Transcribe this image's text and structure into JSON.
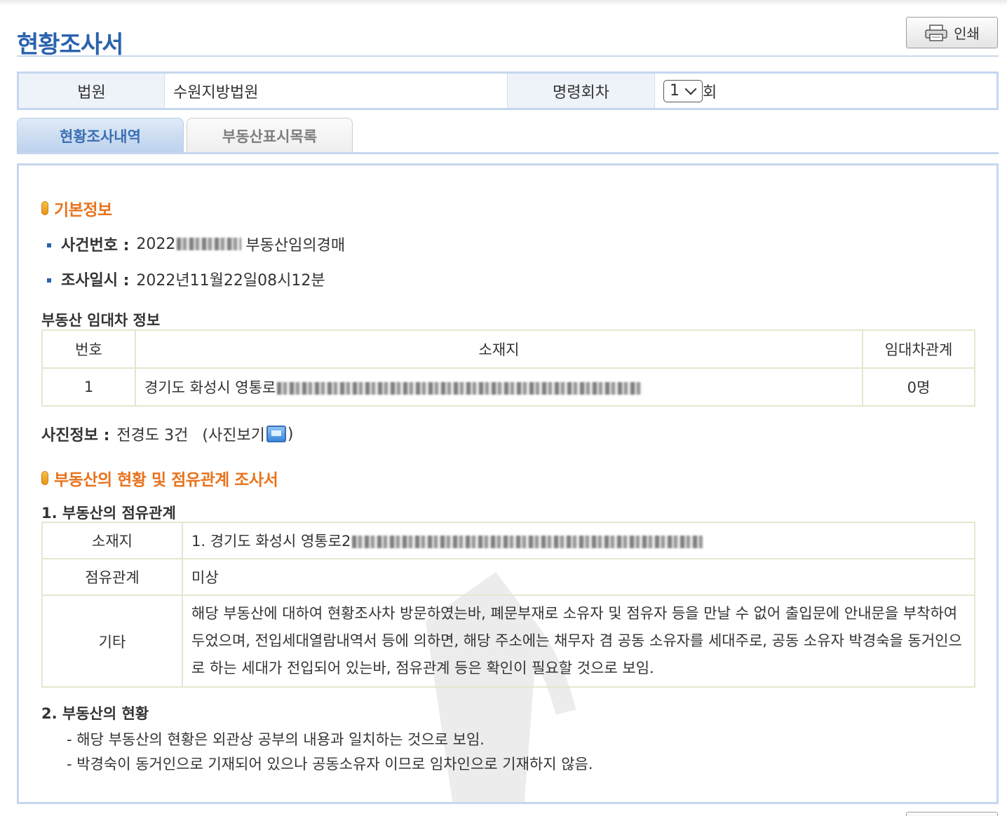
{
  "header": {
    "title": "현황조사서",
    "print_label": "인쇄"
  },
  "court": {
    "court_label": "법원",
    "court_value": "수원지방법원",
    "order_label": "명령회차",
    "order_value": "1",
    "order_suffix": "회"
  },
  "tabs": [
    {
      "label": "현황조사내역",
      "active": true
    },
    {
      "label": "부동산표시목록",
      "active": false
    }
  ],
  "basic_info": {
    "heading": "기본정보",
    "case_label": "사건번호 :",
    "case_prefix": "2022",
    "case_suffix": "부동산임의경매",
    "date_label": "조사일시 :",
    "date_value": "2022년11월22일08시12분"
  },
  "lease_info": {
    "heading": "부동산 임대차 정보",
    "columns": [
      "번호",
      "소재지",
      "임대차관계"
    ],
    "rows": [
      {
        "no": "1",
        "address_prefix": "경기도 화성시 영통로",
        "relation": "0명"
      }
    ]
  },
  "photo_info": {
    "label": "사진정보 :",
    "value": "전경도 3건",
    "view_open": "(사진보기",
    "view_close": ")"
  },
  "status_section": {
    "heading": "부동산의 현황 및 점유관계 조사서",
    "occupancy_heading": "1. 부동산의 점유관계",
    "occupancy_rows": [
      {
        "label": "소재지",
        "value": "1. 경기도 화성시 영통로2"
      },
      {
        "label": "점유관계",
        "value": "미상"
      },
      {
        "label": "기타",
        "value": "해당 부동산에 대하여 현황조사차 방문하였는바, 폐문부재로 소유자 및 점유자 등을 만날 수 없어 출입문에 안내문을 부착하여 두었으며, 전입세대열람내역서 등에 의하면, 해당 주소에는 채무자 겸 공동 소유자를 세대주로, 공동 소유자 박경숙을 동거인으로 하는 세대가 전입되어 있는바, 점유관계 등은 확인이 필요할 것으로 보임."
      }
    ],
    "status_heading": "2. 부동산의 현황",
    "status_notes": [
      "- 해당 부동산의 현황은 외관상 공부의 내용과 일치하는 것으로 보임.",
      "- 박경숙이 동거인으로 기재되어 있으나 공동소유자 이므로 임차인으로 기재하지 않음."
    ]
  },
  "colors": {
    "title_blue": "#2b63ad",
    "accent_orange": "#e8731d",
    "border_blue": "#c5d7ef",
    "table_border": "#e2e8cf"
  },
  "icons": [
    "printer-icon",
    "chevron-down-icon",
    "orange-pill-icon",
    "square-bullet-icon",
    "photo-view-icon"
  ]
}
